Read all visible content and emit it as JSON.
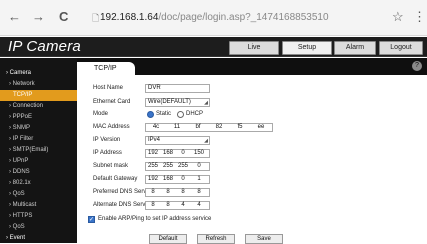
{
  "browser": {
    "back_icon": "←",
    "forward_icon": "→",
    "reload_icon": "C",
    "page_icon": "🗋",
    "url_host": "192.168.1.64",
    "url_path": "/doc/page/login.asp?_1474168853510",
    "star_icon": "☆",
    "menu_icon": "⋮"
  },
  "app": {
    "brand": "IP Camera",
    "nav": {
      "live": "Live",
      "setup": "Setup",
      "alarm": "Alarm",
      "logout": "Logout"
    }
  },
  "sidebar": {
    "items": [
      {
        "label": "› Camera"
      },
      {
        "label": "› Network"
      },
      {
        "label": "TCP/IP"
      },
      {
        "label": "› Connection"
      },
      {
        "label": "› PPPoE"
      },
      {
        "label": "› SNMP"
      },
      {
        "label": "› IP Filter"
      },
      {
        "label": "› SMTP(Email)"
      },
      {
        "label": "› UPnP"
      },
      {
        "label": "› DDNS"
      },
      {
        "label": "› 802.1x"
      },
      {
        "label": "› QoS"
      },
      {
        "label": "› Multicast"
      },
      {
        "label": "› HTTPS"
      },
      {
        "label": "› QoS"
      },
      {
        "label": "› Event"
      }
    ]
  },
  "main": {
    "tab": "TCP/IP",
    "help_icon": "?",
    "host_name": {
      "label": "Host Name",
      "value": "DVR"
    },
    "ethernet_card": {
      "label": "Ethernet Card",
      "value": "Wire(DEFAULT)"
    },
    "mode": {
      "label": "Mode",
      "static": "Static",
      "dhcp": "DHCP",
      "selected": "static"
    },
    "mac": {
      "label": "MAC Address",
      "octets": [
        "4c",
        "11",
        "bf",
        "82",
        "f5",
        "ee"
      ]
    },
    "ip_version": {
      "label": "IP Version",
      "value": "IPv4"
    },
    "ip_address": {
      "label": "IP Address",
      "octets": [
        "192",
        "168",
        "0",
        "150"
      ]
    },
    "subnet_mask": {
      "label": "Subnet mask",
      "octets": [
        "255",
        "255",
        "255",
        "0"
      ]
    },
    "default_gateway": {
      "label": "Default Gateway",
      "octets": [
        "192",
        "168",
        "0",
        "1"
      ]
    },
    "preferred_dns": {
      "label": "Preferred DNS Server",
      "octets": [
        "8",
        "8",
        "8",
        "8"
      ]
    },
    "alternate_dns": {
      "label": "Alternate DNS Server",
      "octets": [
        "8",
        "8",
        "4",
        "4"
      ]
    },
    "arp": {
      "label": "Enable ARP/Ping to set IP address service",
      "checked": true
    },
    "buttons": {
      "default": "Default",
      "refresh": "Refresh",
      "save": "Save"
    }
  }
}
